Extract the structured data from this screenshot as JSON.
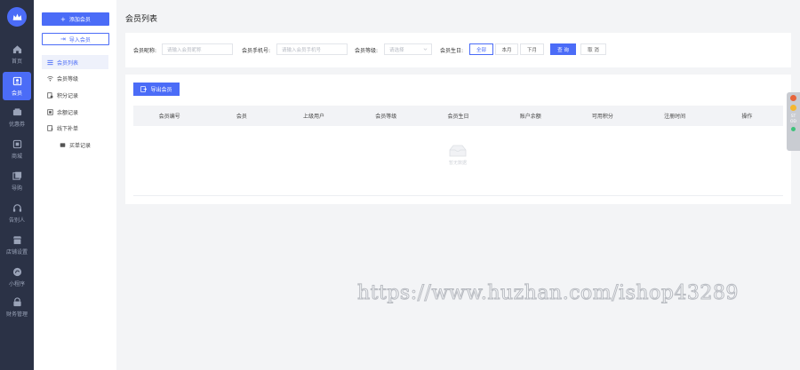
{
  "rail": {
    "items": [
      {
        "label": "首页",
        "icon": "home-icon"
      },
      {
        "label": "会员",
        "icon": "member-icon"
      },
      {
        "label": "优惠券",
        "icon": "coupon-icon"
      },
      {
        "label": "商城",
        "icon": "mall-icon"
      },
      {
        "label": "导购",
        "icon": "guide-icon"
      },
      {
        "label": "告别人",
        "icon": "headset-icon"
      },
      {
        "label": "店铺设置",
        "icon": "store-icon"
      },
      {
        "label": "小程序",
        "icon": "miniprogram-icon"
      },
      {
        "label": "财务管理",
        "icon": "finance-icon"
      }
    ]
  },
  "submenu": {
    "add_member": "添加会员",
    "import_member": "导入会员",
    "items": [
      {
        "label": "会员列表",
        "icon": "list-icon"
      },
      {
        "label": "会员等级",
        "icon": "level-icon"
      },
      {
        "label": "积分记录",
        "icon": "points-icon"
      },
      {
        "label": "余额记录",
        "icon": "balance-icon"
      },
      {
        "label": "线下补单",
        "icon": "offline-order-icon"
      },
      {
        "label": "买单记录",
        "icon": "pay-record-icon"
      }
    ]
  },
  "page": {
    "title": "会员列表"
  },
  "filters": {
    "nickname_label": "会员昵称:",
    "nickname_placeholder": "请输入会员昵称",
    "phone_label": "会员手机号:",
    "phone_placeholder": "请输入会员手机号",
    "level_label": "会员等级:",
    "level_placeholder": "请选择",
    "birthday_label": "会员生日:",
    "birthday_options": [
      "全部",
      "本月",
      "下月"
    ],
    "query": "查 询",
    "cancel": "取 消"
  },
  "list": {
    "export": "导出会员",
    "columns": [
      "会员编号",
      "会员",
      "上级用户",
      "会员等级",
      "会员生日",
      "账户余额",
      "可用积分",
      "注册时间",
      "操作"
    ],
    "empty_text": "暂无数据"
  },
  "float_tool": {
    "text_1": "ST",
    "text_2": "OD"
  },
  "watermark": "https://www.huzhan.com/ishop43289",
  "colors": {
    "primary": "#4b6cf7",
    "rail_bg": "#2b3246",
    "page_bg": "#f3f4f6"
  }
}
